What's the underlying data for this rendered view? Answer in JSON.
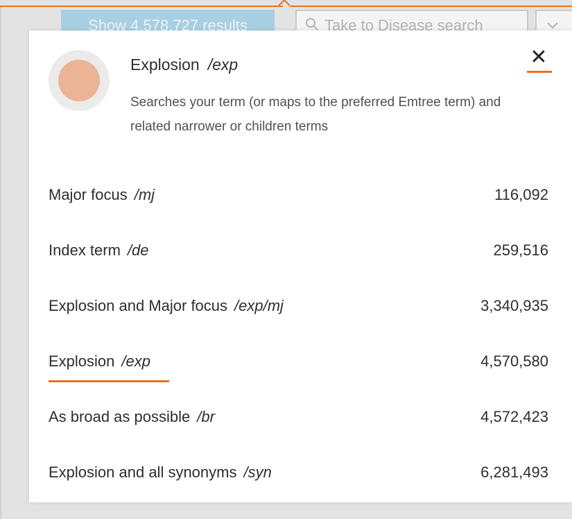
{
  "background": {
    "show_results_label": "Show 4,578,727 results",
    "search_placeholder": "Take to Disease search"
  },
  "popup": {
    "close_label": "✕",
    "icon": "circle-swatch-icon",
    "title": "Explosion",
    "title_tag": "/exp",
    "description": "Searches your term (or maps to the preferred Emtree term) and related narrower or children terms",
    "options": [
      {
        "label": "Major focus",
        "tag": "/mj",
        "count": "116,092",
        "selected": false
      },
      {
        "label": "Index term",
        "tag": "/de",
        "count": "259,516",
        "selected": false
      },
      {
        "label": "Explosion and Major focus",
        "tag": "/exp/mj",
        "count": "3,340,935",
        "selected": false
      },
      {
        "label": "Explosion",
        "tag": "/exp",
        "count": "4,570,580",
        "selected": true
      },
      {
        "label": "As broad as possible",
        "tag": "/br",
        "count": "4,572,423",
        "selected": false
      },
      {
        "label": "Explosion and all synonyms",
        "tag": "/syn",
        "count": "6,281,493",
        "selected": false
      }
    ]
  },
  "colors": {
    "accent": "#e9711c",
    "swatch": "#ebb494",
    "show_button": "#a9cfe2"
  }
}
